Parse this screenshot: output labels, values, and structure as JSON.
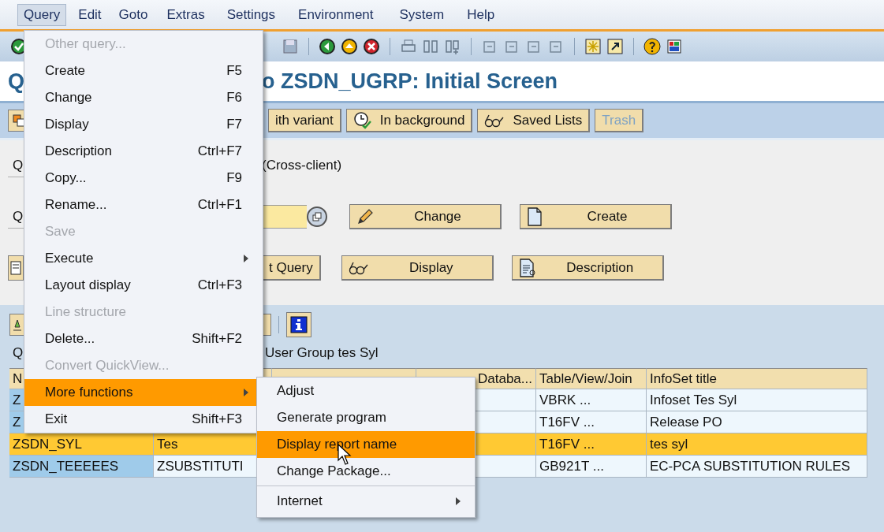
{
  "menubar": [
    {
      "label": "Query",
      "selected": true
    },
    {
      "label": "Edit",
      "selected": false
    },
    {
      "label": "Goto",
      "selected": false
    },
    {
      "label": "Extras",
      "selected": false
    },
    {
      "label": "Settings",
      "selected": false
    },
    {
      "label": "Environment",
      "selected": false
    },
    {
      "label": "System",
      "selected": false
    },
    {
      "label": "Help",
      "selected": false
    }
  ],
  "title_parts": [
    "Q",
    "o ZSDN_UGRP: Initial Screen"
  ],
  "app_toolbar": [
    {
      "label": "ith variant",
      "disabled": false
    },
    {
      "label": "In background",
      "disabled": false
    },
    {
      "label": "Saved Lists",
      "disabled": false
    },
    {
      "label": "Trash",
      "disabled": true
    }
  ],
  "form_row_1": {
    "label_fragment": "Q",
    "text": "(Cross-client)"
  },
  "form_row_2": {
    "label_fragment": "Q",
    "buttons": [
      {
        "label": "Change"
      },
      {
        "label": "Create"
      }
    ]
  },
  "form_row_3": {
    "button_fragment": "t Query",
    "buttons": [
      {
        "label": "Display"
      },
      {
        "label": "Description"
      }
    ]
  },
  "list_header": {
    "label_fragment": "Q",
    "text": "User Group tes Syl"
  },
  "table": {
    "columns": [
      {
        "label": "N"
      },
      {},
      {},
      {
        "label": "Databa..."
      },
      {
        "label": "Table/View/Join"
      },
      {
        "label": "InfoSet title"
      }
    ],
    "rows": [
      {
        "selected": false,
        "cells": [
          "Z",
          null,
          null,
          null,
          "VBRK ...",
          "Infoset Tes Syl"
        ]
      },
      {
        "selected": false,
        "cells": [
          "Z",
          null,
          null,
          null,
          "T16FV ...",
          "Release PO"
        ]
      },
      {
        "selected": true,
        "cells": [
          "ZSDN_SYL",
          "Tes",
          null,
          null,
          "T16FV ...",
          "tes syl"
        ]
      },
      {
        "selected": false,
        "cells": [
          "ZSDN_TEEEEES",
          "ZSUBSTITUTI",
          null,
          null,
          "GB921T ...",
          "EC-PCA SUBSTITUTION RULES"
        ]
      }
    ]
  },
  "menu": [
    {
      "kind": "item",
      "label": "Other query...",
      "disabled": true,
      "submenu": false,
      "selected": false
    },
    {
      "kind": "item",
      "label": "Create",
      "shortcut": "F5",
      "disabled": false,
      "submenu": false,
      "selected": false
    },
    {
      "kind": "item",
      "label": "Change",
      "shortcut": "F6",
      "disabled": false,
      "submenu": false,
      "selected": false
    },
    {
      "kind": "item",
      "label": "Display",
      "shortcut": "F7",
      "disabled": false,
      "submenu": false,
      "selected": false
    },
    {
      "kind": "item",
      "label": "Description",
      "shortcut": "Ctrl+F7",
      "disabled": false,
      "submenu": false,
      "selected": false
    },
    {
      "kind": "item",
      "label": "Copy...",
      "shortcut": "F9",
      "disabled": false,
      "submenu": false,
      "selected": false
    },
    {
      "kind": "item",
      "label": "Rename...",
      "shortcut": "Ctrl+F1",
      "disabled": false,
      "submenu": false,
      "selected": false
    },
    {
      "kind": "item",
      "label": "Save",
      "disabled": true,
      "submenu": false,
      "selected": false
    },
    {
      "kind": "item",
      "label": "Execute",
      "disabled": false,
      "submenu": true,
      "selected": false
    },
    {
      "kind": "item",
      "label": "Layout display",
      "shortcut": "Ctrl+F3",
      "disabled": false,
      "submenu": false,
      "selected": false
    },
    {
      "kind": "item",
      "label": "Line structure",
      "disabled": true,
      "submenu": false,
      "selected": false
    },
    {
      "kind": "item",
      "label": "Delete...",
      "shortcut": "Shift+F2",
      "disabled": false,
      "submenu": false,
      "selected": false
    },
    {
      "kind": "item",
      "label": "Convert QuickView...",
      "disabled": true,
      "submenu": false,
      "selected": false
    },
    {
      "kind": "item",
      "label": "More functions",
      "disabled": false,
      "submenu": true,
      "selected": true
    },
    {
      "kind": "item",
      "label": "Exit",
      "shortcut": "Shift+F3",
      "disabled": false,
      "submenu": false,
      "selected": false
    }
  ],
  "submenu": [
    {
      "kind": "item",
      "label": "Adjust",
      "submenu": false,
      "selected": false
    },
    {
      "kind": "item",
      "label": "Generate program",
      "submenu": false,
      "selected": false
    },
    {
      "kind": "item",
      "label": "Display report name",
      "submenu": false,
      "selected": true
    },
    {
      "kind": "item",
      "label": "Change Package...",
      "submenu": false,
      "selected": false
    },
    {
      "kind": "separator"
    },
    {
      "kind": "item",
      "label": "Internet",
      "submenu": true,
      "selected": false
    }
  ]
}
